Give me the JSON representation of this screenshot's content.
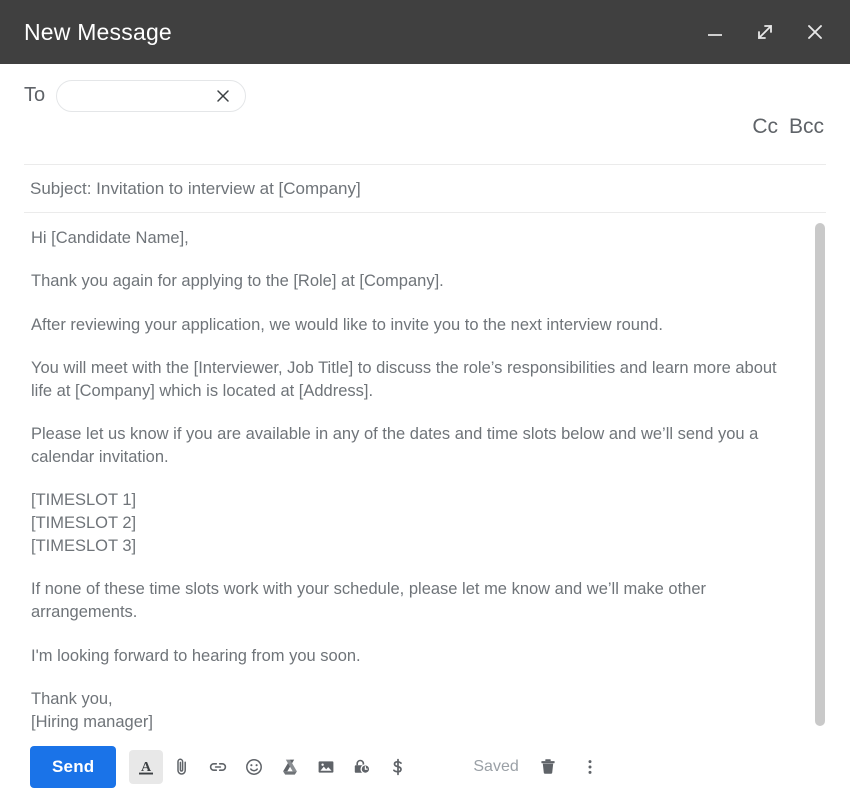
{
  "window": {
    "title": "New Message",
    "header_bg": "#404040",
    "minimize_icon": "minimize-icon",
    "expand_icon": "expand-icon",
    "close_icon": "close-icon"
  },
  "recipients": {
    "to_label": "To",
    "to_value": "",
    "to_placeholder": "",
    "chip_close_icon": "close-icon",
    "cc_label": "Cc",
    "bcc_label": "Bcc"
  },
  "subject": {
    "text": "Subject: Invitation to interview at [Company]",
    "placeholder": "Subject"
  },
  "body": {
    "paragraphs": [
      "Hi [Candidate Name],",
      "Thank you again for applying to the [Role] at [Company].",
      "After reviewing your application, we would like to invite you to the next interview round.",
      "You will meet with the [Interviewer, Job Title] to discuss the role’s responsibilities and learn more about life at [Company] which is located at [Address].",
      "Please let us know if you are available in any of the dates and time slots below and we’ll send you a calendar invitation.",
      "[TIMESLOT 1]",
      "[TIMESLOT 2]",
      "[TIMESLOT 3]",
      "If none of these time slots work with your schedule, please let me know and we’ll make other arrangements.",
      "I'm looking forward to hearing from you soon.",
      "Thank you,",
      "[Hiring manager]"
    ]
  },
  "toolbar": {
    "send_label": "Send",
    "saved_label": "Saved",
    "accent_color": "#1a73e8",
    "icons": [
      {
        "name": "formatting-options-icon",
        "label": "Formatting options",
        "active": true
      },
      {
        "name": "attach-file-icon",
        "label": "Attach files",
        "active": false
      },
      {
        "name": "insert-link-icon",
        "label": "Insert link",
        "active": false
      },
      {
        "name": "insert-emoji-icon",
        "label": "Insert emoji",
        "active": false
      },
      {
        "name": "insert-drive-file-icon",
        "label": "Insert files using Drive",
        "active": false
      },
      {
        "name": "insert-photo-icon",
        "label": "Insert photo",
        "active": false
      },
      {
        "name": "confidential-mode-icon",
        "label": "Toggle confidential mode",
        "active": false
      },
      {
        "name": "insert-money-icon",
        "label": "Insert money",
        "active": false
      }
    ],
    "discard_icon": "trash-icon",
    "more_options_icon": "more-options-icon"
  }
}
